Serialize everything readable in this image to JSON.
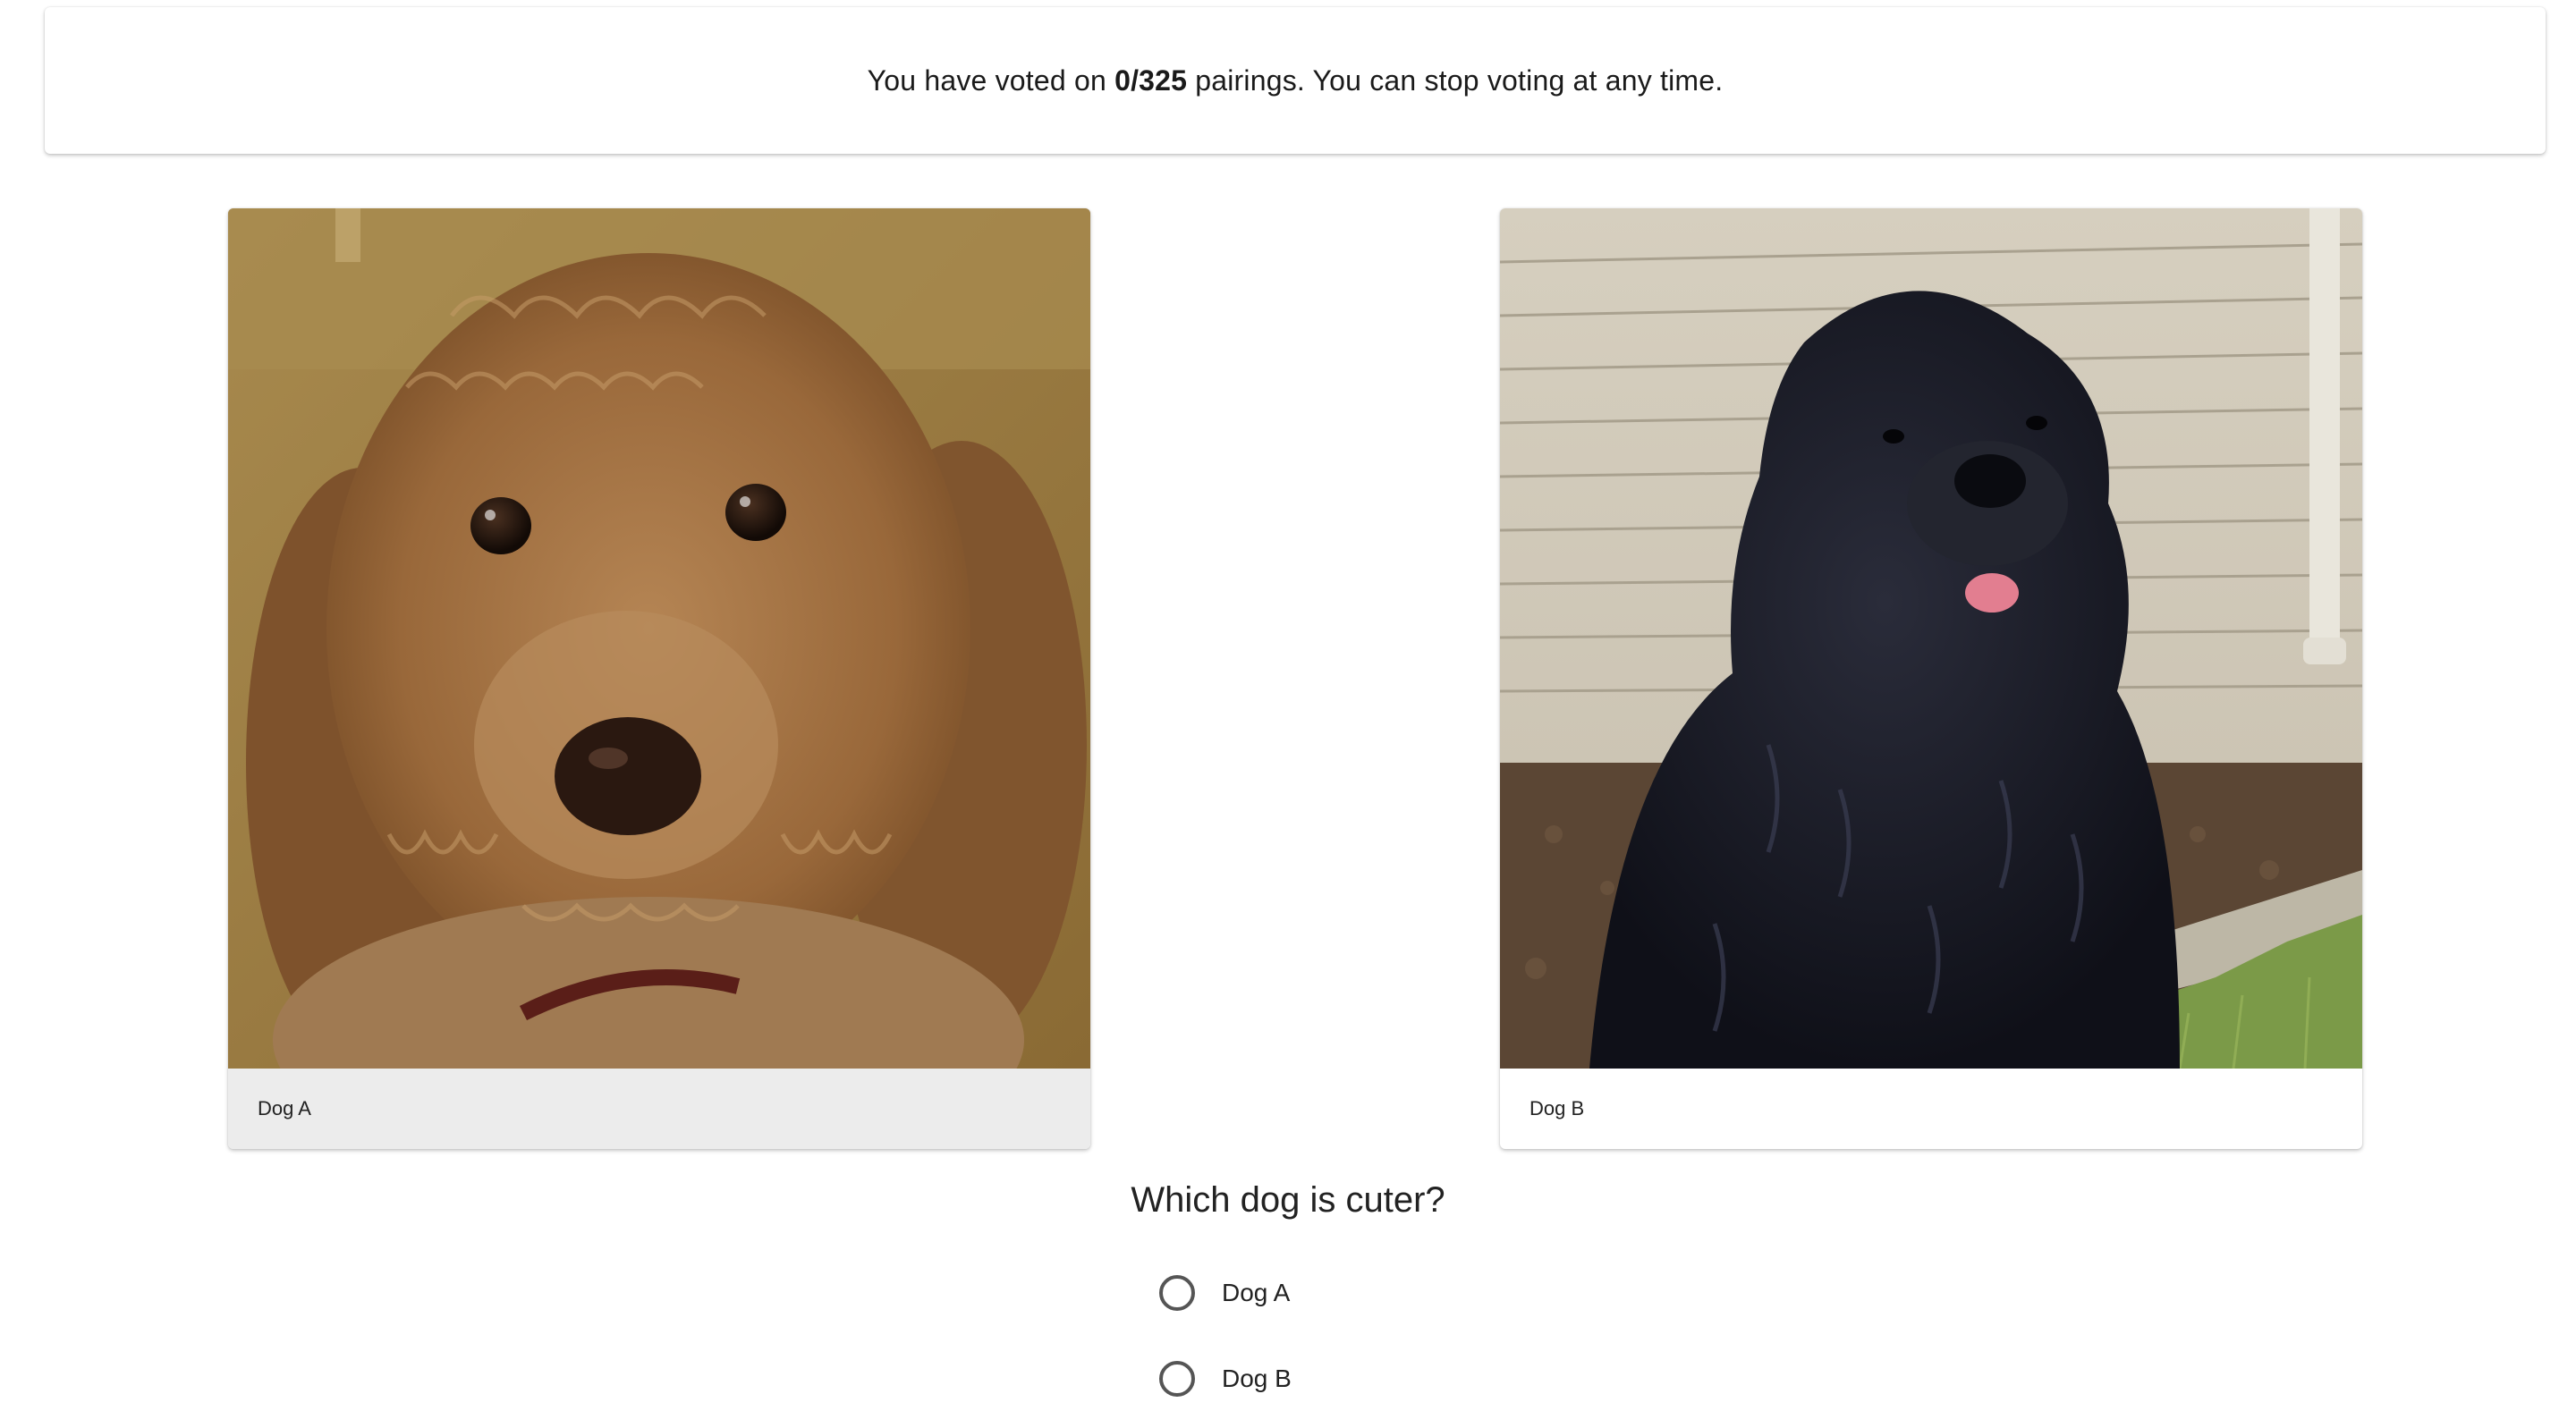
{
  "banner": {
    "prefix": "You have voted on ",
    "count": "0/325",
    "suffix": " pairings. You can stop voting at any time."
  },
  "cards": [
    {
      "label": "Dog A",
      "photo": "dog-a-photo"
    },
    {
      "label": "Dog B",
      "photo": "dog-b-photo"
    }
  ],
  "question": "Which dog is cuter?",
  "options": [
    {
      "label": "Dog A",
      "selected": false
    },
    {
      "label": "Dog B",
      "selected": false
    }
  ],
  "colors": {
    "hover_caption": "#ececec",
    "radio_border": "#555555"
  }
}
